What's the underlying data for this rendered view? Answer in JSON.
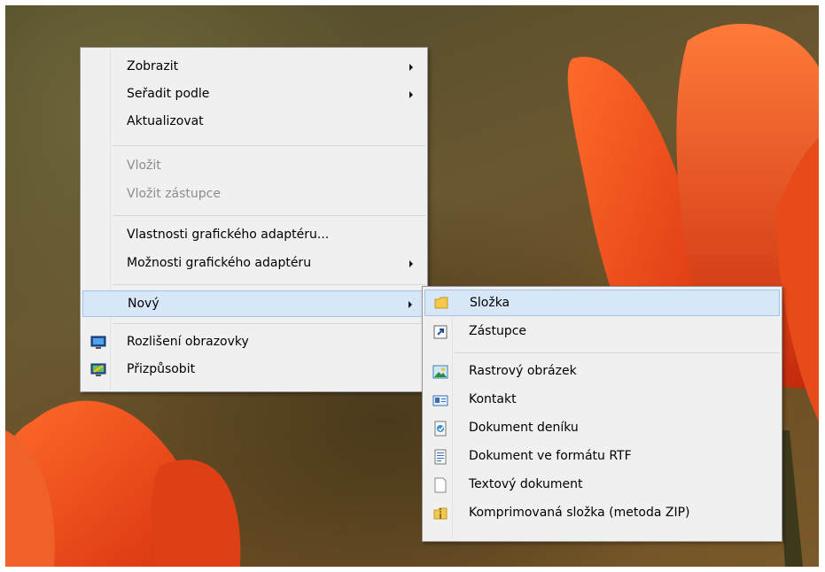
{
  "context_menu": {
    "items": [
      {
        "label": "Zobrazit",
        "has_submenu": true,
        "enabled": true
      },
      {
        "label": "Seřadit podle",
        "has_submenu": true,
        "enabled": true
      },
      {
        "label": "Aktualizovat",
        "has_submenu": false,
        "enabled": true
      },
      {
        "label": "Vložit",
        "has_submenu": false,
        "enabled": false
      },
      {
        "label": "Vložit zástupce",
        "has_submenu": false,
        "enabled": false
      },
      {
        "label": "Vlastnosti grafického adaptéru...",
        "has_submenu": false,
        "enabled": true
      },
      {
        "label": "Možnosti grafického adaptéru",
        "has_submenu": true,
        "enabled": true
      },
      {
        "label": "Nový",
        "has_submenu": true,
        "enabled": true,
        "highlighted": true
      },
      {
        "label": "Rozlišení obrazovky",
        "has_submenu": false,
        "enabled": true,
        "icon": "display-icon"
      },
      {
        "label": "Přizpůsobit",
        "has_submenu": false,
        "enabled": true,
        "icon": "personalize-icon"
      }
    ]
  },
  "submenu_new": {
    "items": [
      {
        "label": "Složka",
        "icon": "folder-icon",
        "highlighted": true
      },
      {
        "label": "Zástupce",
        "icon": "shortcut-icon"
      },
      {
        "label": "Rastrový obrázek",
        "icon": "bitmap-image-icon"
      },
      {
        "label": "Kontakt",
        "icon": "contact-icon"
      },
      {
        "label": "Dokument deníku",
        "icon": "journal-document-icon"
      },
      {
        "label": "Dokument ve formátu RTF",
        "icon": "rtf-document-icon"
      },
      {
        "label": "Textový dokument",
        "icon": "text-document-icon"
      },
      {
        "label": "Komprimovaná složka (metoda ZIP)",
        "icon": "zip-folder-icon"
      }
    ]
  },
  "colors": {
    "menu_background": "#f0f0f0",
    "highlight_fill": "#d7e7f7",
    "highlight_border": "#9fc5ec",
    "disabled_text": "#8d8d8d"
  }
}
